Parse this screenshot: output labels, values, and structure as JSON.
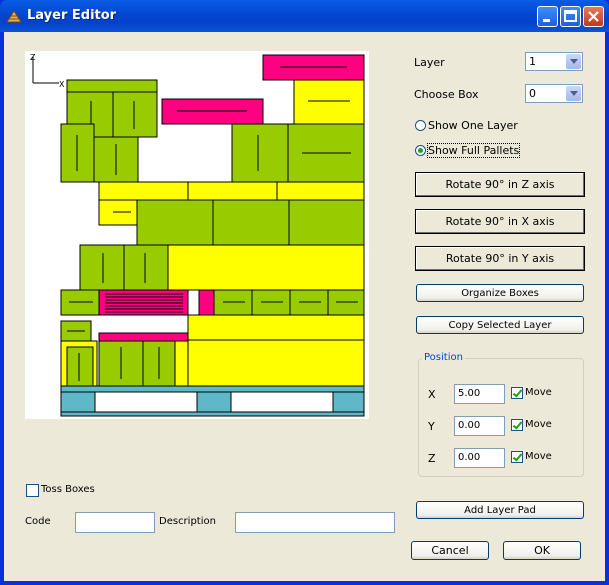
{
  "window": {
    "title": "Layer Editor"
  },
  "colors": {
    "green": "#99cc00",
    "yellow": "#ffff00",
    "magenta": "#ff0080",
    "pallet": "#5fb8c8"
  },
  "axes": {
    "z": "Z",
    "x": "X"
  },
  "layer": {
    "label": "Layer",
    "value": "1"
  },
  "choose_box": {
    "label": "Choose Box",
    "value": "0"
  },
  "view": {
    "show_one": "Show One Layer",
    "show_full": "Show Full Pallets",
    "selected": "show_full"
  },
  "buttons": {
    "rotate_z": "Rotate 90° in Z axis",
    "rotate_x": "Rotate 90° in X axis",
    "rotate_y": "Rotate 90° in Y axis",
    "organize": "Organize Boxes",
    "copy_layer": "Copy Selected Layer",
    "add_pad": "Add Layer Pad",
    "cancel": "Cancel",
    "ok": "OK"
  },
  "position": {
    "title": "Position",
    "move_label": "Move",
    "rows": [
      {
        "axis": "X",
        "value": "5.00",
        "move": true
      },
      {
        "axis": "Y",
        "value": "0.00",
        "move": true
      },
      {
        "axis": "Z",
        "value": "0.00",
        "move": true
      }
    ]
  },
  "toss_boxes": {
    "label": "Toss Boxes",
    "checked": false
  },
  "code": {
    "label": "Code",
    "value": ""
  },
  "description": {
    "label": "Description",
    "value": ""
  }
}
